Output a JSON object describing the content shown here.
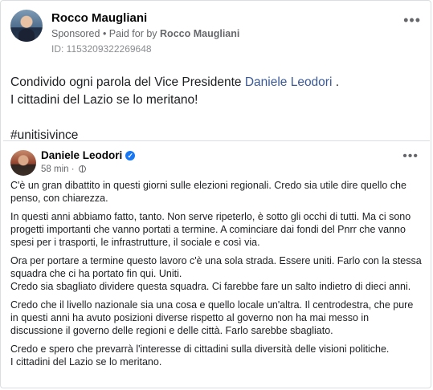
{
  "post": {
    "author": "Rocco Maugliani",
    "sponsored_label": "Sponsored",
    "separator": " • ",
    "paid_for_label": "Paid for by ",
    "paid_for_name": "Rocco Maugliani",
    "id_line": "ID: 1153209322269648",
    "menu_icon": "more-horizontal-icon",
    "text_line1_before": "Condivido ogni parola del Vice Presidente ",
    "text_line1_link": "Daniele Leodori",
    "text_line1_after": " .",
    "text_line2": "I cittadini del Lazio se lo meritano!",
    "hashtag": "#unitisivince"
  },
  "shared": {
    "author": "Daniele Leodori",
    "verified_icon": "verified-badge-icon",
    "time": "58 min",
    "time_separator": " · ",
    "audience_icon": "globe-icon",
    "paragraphs": [
      "C'è un gran dibattito in questi giorni sulle elezioni regionali. Credo sia utile dire quello che penso, con chiarezza.",
      "In questi anni abbiamo fatto, tanto. Non serve ripeterlo, è sotto gli occhi di tutti. Ma ci sono progetti importanti che vanno portati a termine. A cominciare dai fondi del Pnrr che vanno spesi per i trasporti, le infrastrutture, il sociale e così via.",
      "Ora per portare a termine questo lavoro c'è una sola strada. Essere uniti. Farlo con la stessa squadra che ci ha portato fin qui. Uniti.\nCredo sia sbagliato dividere questa squadra. Ci farebbe fare un salto indietro di dieci anni.",
      "Credo che il livello nazionale sia una cosa e quello locale un'altra. Il centrodestra, che pure in questi anni ha avuto posizioni diverse rispetto al governo non ha mai messo in discussione il governo delle regioni e delle città. Farlo sarebbe sbagliato.",
      "Credo e spero che prevarrà l'interesse di cittadini sulla diversità delle visioni politiche.\nI cittadini del Lazio se lo meritano."
    ]
  }
}
